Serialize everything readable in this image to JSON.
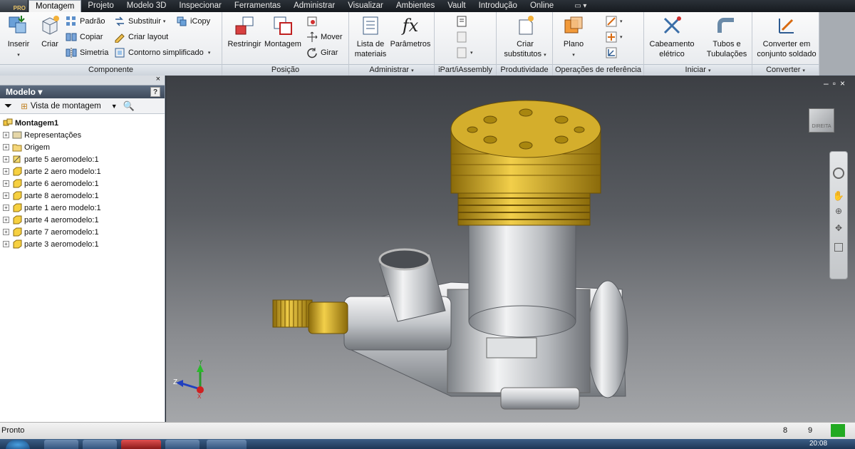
{
  "app": {
    "badge": "PRO"
  },
  "menu": {
    "tabs": [
      "Montagem",
      "Projeto",
      "Modelo 3D",
      "Inspecionar",
      "Ferramentas",
      "Administrar",
      "Visualizar",
      "Ambientes",
      "Vault",
      "Introdução",
      "Online"
    ],
    "active_tab": "Montagem"
  },
  "ribbon": {
    "componente": {
      "title": "Componente",
      "inserir": "Inserir",
      "criar": "Criar",
      "padrao": "Padrão",
      "copiar": "Copiar",
      "simetria": "Simetria",
      "substituir": "Substituir",
      "criar_layout": "Criar layout",
      "contorno": "Contorno simplificado",
      "icopy": "iCopy"
    },
    "posicao": {
      "title": "Posição",
      "restringir": "Restringir",
      "montagem": "Montagem",
      "mover": "Mover",
      "girar": "Girar"
    },
    "administrar": {
      "title": "Administrar",
      "lista_line1": "Lista de",
      "lista_line2": "materiais",
      "parametros": "Parâmetros"
    },
    "ipart": {
      "title": "iPart/iAssembly"
    },
    "produtividade": {
      "title": "Produtividade",
      "criar_line1": "Criar",
      "criar_line2": "substitutos"
    },
    "referencia": {
      "title": "Operações de referência",
      "plano": "Plano"
    },
    "iniciar": {
      "title": "Iniciar",
      "cab_line1": "Cabeamento",
      "cab_line2": "elétrico",
      "tubos_line1": "Tubos e",
      "tubos_line2": "Tubulações"
    },
    "converter": {
      "title": "Converter",
      "conv_line1": "Converter em",
      "conv_line2": "conjunto soldado"
    }
  },
  "browser": {
    "title": "Modelo",
    "view_label": "Vista de montagem",
    "root": "Montagem1",
    "items": [
      {
        "label": "Representações"
      },
      {
        "label": "Origem"
      },
      {
        "label": "parte 5 aeromodelo:1"
      },
      {
        "label": "parte 2 aero modelo:1"
      },
      {
        "label": "parte 6 aeromodelo:1"
      },
      {
        "label": "parte 8 aeromodelo:1"
      },
      {
        "label": "parte 1 aero modelo:1"
      },
      {
        "label": "parte 4 aeromodelo:1"
      },
      {
        "label": "parte 7 aeromodelo:1"
      },
      {
        "label": "parte 3 aeromodelo:1"
      }
    ]
  },
  "viewport": {
    "viewcube_face": "DIREITA",
    "axes": {
      "y": "Y",
      "z": "Z",
      "x": "X"
    }
  },
  "status": {
    "text": "Pronto",
    "num1": "8",
    "num2": "9",
    "clock": "20:08"
  },
  "colors": {
    "ribbon_bg": "#eef0f3",
    "menubar": "#1f242a",
    "browser_header": "#4d5a6c",
    "gold": "#c8a020",
    "steel": "#c9ccd0",
    "status_green": "#22aa22"
  }
}
